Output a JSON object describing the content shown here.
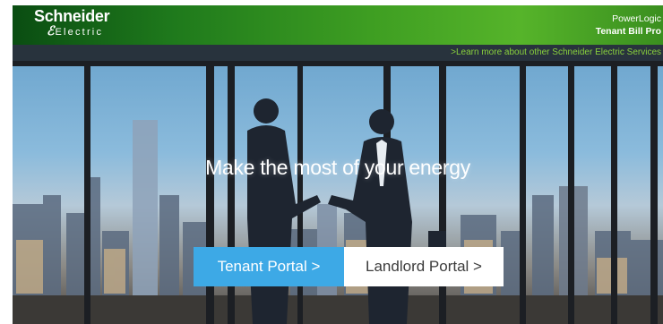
{
  "header": {
    "logo": {
      "brand": "Schneider",
      "sub": "Electric"
    },
    "product": {
      "line1": "PowerLogic",
      "line2": "Tenant Bill Pro"
    }
  },
  "subnav": {
    "link_label": ">Learn more about other Schneider Electric Services"
  },
  "hero": {
    "tagline": "Make the most of your energy",
    "tenant_portal_label": "Tenant Portal >",
    "landlord_portal_label": "Landlord Portal >"
  },
  "colors": {
    "brand_green": "#3e9e22",
    "link_green": "#8ad13d",
    "tenant_button": "#3da9e6",
    "landlord_button": "#ffffff",
    "subbar": "#16222c"
  }
}
